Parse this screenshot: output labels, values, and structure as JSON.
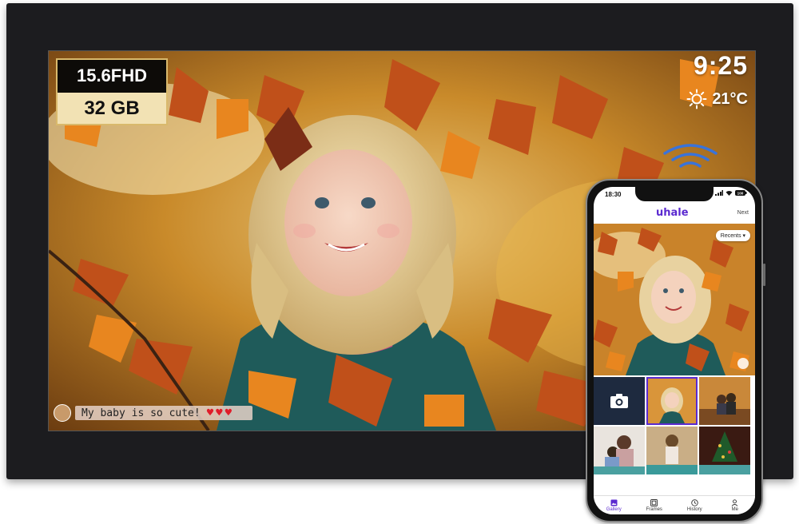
{
  "frame": {
    "spec_resolution": "15.6FHD",
    "spec_storage": "32 GB",
    "clock": "9:25",
    "temperature": "21°C",
    "caption": "My baby is so cute!",
    "icons": [
      "sun-icon",
      "wifi-icon",
      "heart-icon"
    ],
    "accent_gold": "#d9b96c"
  },
  "phone": {
    "status_time": "18:30",
    "battery": "100",
    "app_name": "uhale",
    "next_label": "Next",
    "recents_label": "Recents",
    "tabs": [
      {
        "label": "Gallery",
        "icon": "gallery-icon",
        "active": true
      },
      {
        "label": "Frames",
        "icon": "frames-icon",
        "active": false
      },
      {
        "label": "History",
        "icon": "history-icon",
        "active": false
      },
      {
        "label": "Me",
        "icon": "person-icon",
        "active": false
      }
    ],
    "accent": "#5b2ad0"
  }
}
